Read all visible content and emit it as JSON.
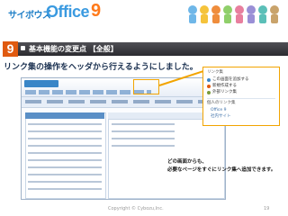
{
  "header": {
    "brand_cybozu": "サイボウズ",
    "brand_office": "Office",
    "brand_version": "9"
  },
  "section": {
    "number": "9",
    "title": "基本機能の変更点 【全般】"
  },
  "heading": "リンク集の操作をヘッダから行えるようにしました。",
  "popup_menu": {
    "section_label": "リンク集",
    "items": [
      "この画面を追加する",
      "新規作成する",
      "外部リンク集"
    ],
    "personal_label": "個人のリンク集",
    "sub_items": [
      "Office 9",
      "社内サイト"
    ]
  },
  "annotation": {
    "line1": "どの画面からも、",
    "line2": "必要なページをすぐにリンク集へ追加できます。"
  },
  "footer": {
    "copyright": "Copyright © Cybozu,Inc.",
    "page": "19"
  },
  "colors": {
    "accent": "#e05a10",
    "brand_blue": "#3a9ae0",
    "highlight": "#f2a400",
    "bar_dark": "#2b2b30"
  }
}
